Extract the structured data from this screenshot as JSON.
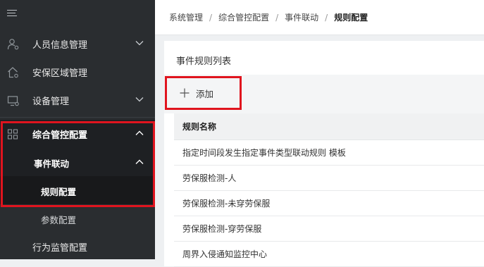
{
  "sidebar": {
    "items": [
      {
        "label": "人员信息管理",
        "icon": "user-settings-icon",
        "has_chevron": true
      },
      {
        "label": "安保区域管理",
        "icon": "home-settings-icon",
        "has_chevron": false
      },
      {
        "label": "设备管理",
        "icon": "monitor-settings-icon",
        "has_chevron": true
      },
      {
        "label": "综合管控配置",
        "icon": "grid-icon",
        "has_chevron": true,
        "expanded": true
      },
      {
        "label": "行为监管配置",
        "icon": "",
        "has_chevron": false
      }
    ],
    "sub_items": [
      {
        "label": "事件联动",
        "expanded": true
      },
      {
        "label": "规则配置",
        "selected": true
      },
      {
        "label": "参数配置"
      }
    ]
  },
  "breadcrumb": [
    "系统管理",
    "综合管控配置",
    "事件联动",
    "规则配置"
  ],
  "panel": {
    "title": "事件规则列表",
    "add_label": "添加"
  },
  "table": {
    "header": "规则名称",
    "rows": [
      "指定时间段发生指定事件类型联动规则 模板",
      "劳保服检测-人",
      "劳保服检测-未穿劳保服",
      "劳保服检测-穿劳保服",
      "周界入侵通知监控中心"
    ]
  },
  "colors": {
    "sidebar_bg": "#2a2d30",
    "highlight_border": "#e0141e"
  }
}
